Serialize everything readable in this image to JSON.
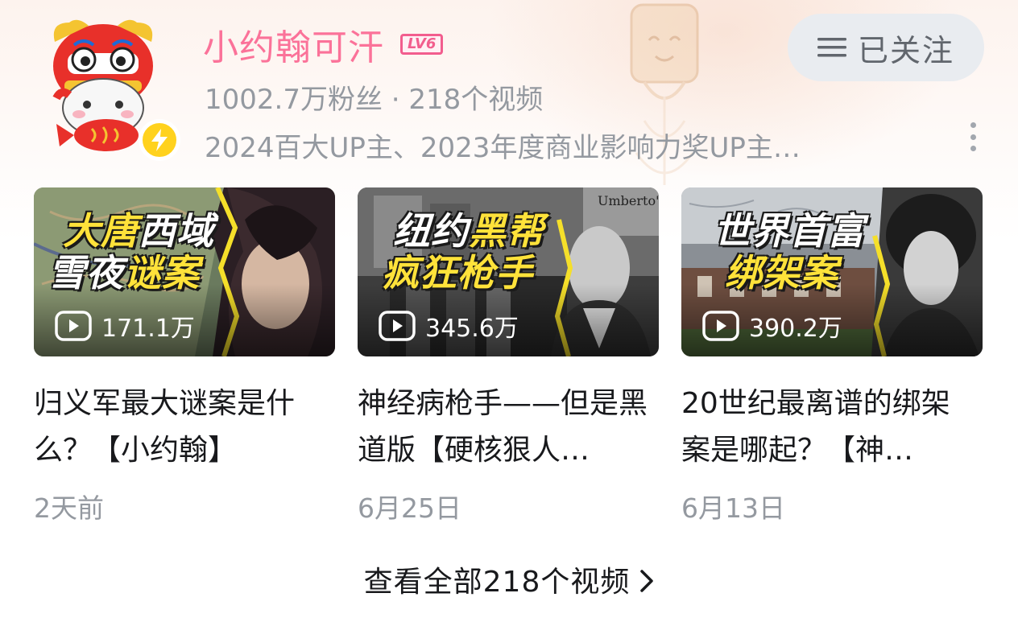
{
  "colors": {
    "name": "#fb7299",
    "level_badge": "#f25d8e",
    "muted_text": "#9499a0",
    "follow_bg": "#e9ecf0",
    "bolt_badge": "#ffd21e"
  },
  "profile": {
    "name": "小约翰可汗",
    "level": "LV6",
    "stats": "1002.7万粉丝 · 218个视频",
    "signature": "2024百大UP主、2023年度商业影响力奖UP主…",
    "avatar_icon": "lion-dance-hamster-avatar",
    "badge_icon": "lightning-bolt-icon"
  },
  "follow": {
    "label": "已关注",
    "icon": "menu-lines-icon"
  },
  "videos": [
    {
      "thumb_title_line1_a": "大唐",
      "thumb_title_line1_b": "西域",
      "thumb_title_line2_a": "雪夜",
      "thumb_title_line2_b": "谜案",
      "views": "171.1万",
      "title": "归义军最大谜案是什么？【小约翰】",
      "date": "2天前"
    },
    {
      "thumb_title_line1_a": "纽约",
      "thumb_title_line1_b": "黑帮",
      "thumb_title_line2_a": "疯狂枪手",
      "thumb_title_line2_b": "",
      "views": "345.6万",
      "title": "神经病枪手——但是黑道版【硬核狠人…",
      "date": "6月25日"
    },
    {
      "thumb_title_line1_a": "世界首富",
      "thumb_title_line1_b": "",
      "thumb_title_line2_a": "绑架案",
      "thumb_title_line2_b": "",
      "views": "390.2万",
      "title": "20世纪最离谱的绑架案是哪起？【神…",
      "date": "6月13日"
    }
  ],
  "view_all": {
    "label": "查看全部218个视频",
    "icon": "chevron-right-icon"
  }
}
